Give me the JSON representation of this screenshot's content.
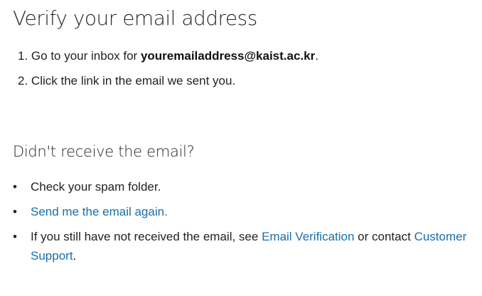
{
  "title": "Verify your email address",
  "steps": [
    {
      "number": "1.",
      "prefix": "Go to your inbox for ",
      "email": "youremailaddress@kaist.ac.kr",
      "suffix": "."
    },
    {
      "number": "2.",
      "text": "Click the link in the email we sent you."
    }
  ],
  "subtitle": "Didn't receive the email?",
  "tips": {
    "bullet": "•",
    "check_spam": "Check your spam folder.",
    "resend_link": "Send me the email again.",
    "still_prefix": "If you still have not received the email, see ",
    "email_verification_link": "Email Verification",
    "still_middle": " or contact ",
    "customer_support_link": "Customer Support",
    "still_suffix": "."
  },
  "colors": {
    "link": "#1a6ea8",
    "text": "#222222"
  }
}
